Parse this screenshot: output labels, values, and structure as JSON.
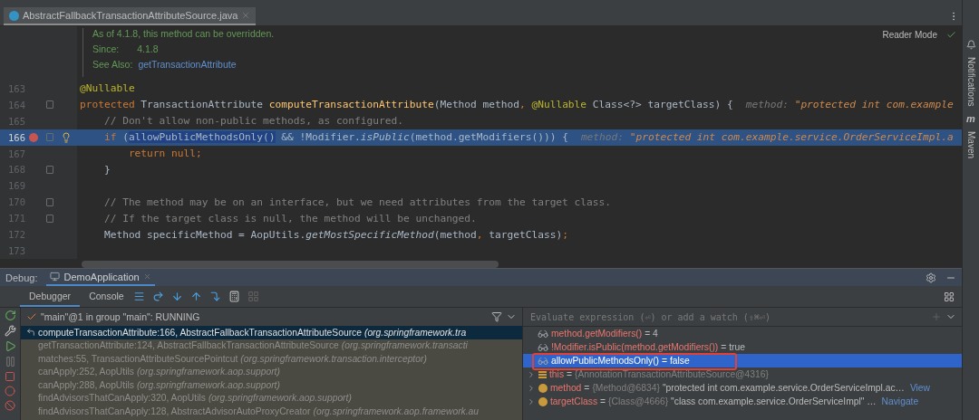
{
  "editor_tab": {
    "label": "AbstractFallbackTransactionAttributeSource.java",
    "selected": true
  },
  "reader_mode": "Reader Mode",
  "doc": {
    "note": "As of 4.1.8, this method can be overridden.",
    "since_label": "Since:",
    "since_value": "4.1.8",
    "see_label": "See Also:",
    "see_link": "getTransactionAttribute"
  },
  "code_lines": [
    {
      "number": "163",
      "current": false,
      "breakpoint": false,
      "fold": false,
      "tokens": [
        {
          "t": "@Nullable",
          "kind": "annotation"
        }
      ]
    },
    {
      "number": "164",
      "current": false,
      "breakpoint": false,
      "fold": true,
      "tokens": [
        {
          "t": "protected",
          "kind": "keyword"
        },
        {
          "t": " TransactionAttribute ",
          "kind": "plain"
        },
        {
          "t": "computeTransactionAttribute",
          "kind": "declaration"
        },
        {
          "t": "(Method method",
          "kind": "plain"
        },
        {
          "t": ", ",
          "kind": "keyword"
        },
        {
          "t": "@Nullable",
          "kind": "annotation"
        },
        {
          "t": " Class<?> targetClass) {",
          "kind": "plain"
        }
      ],
      "hint_key": "method:",
      "hint_value": "\"protected int com.example"
    },
    {
      "number": "165",
      "current": false,
      "breakpoint": false,
      "fold": false,
      "tokens": [
        {
          "t": "    // Don't allow non-public methods, as configured.",
          "kind": "comment"
        }
      ]
    },
    {
      "number": "166",
      "current": true,
      "breakpoint": true,
      "fold": true,
      "tokens": [
        {
          "t": "    if",
          "kind": "keyword"
        },
        {
          "t": " (",
          "kind": "plain"
        },
        {
          "t": "allowPublicMethodsOnly()",
          "kind": "selection"
        },
        {
          "t": " && !Modifier.",
          "kind": "plain"
        },
        {
          "t": "isPublic",
          "kind": "static"
        },
        {
          "t": "(method.getModifiers())) {",
          "kind": "plain"
        }
      ],
      "hint_key": "method:",
      "hint_value": "\"protected int com.example.service.OrderServiceImpl.a"
    },
    {
      "number": "167",
      "current": false,
      "breakpoint": false,
      "fold": false,
      "tokens": [
        {
          "t": "        return null;",
          "kind": "keyword"
        }
      ]
    },
    {
      "number": "168",
      "current": false,
      "breakpoint": false,
      "fold": true,
      "tokens": [
        {
          "t": "    }",
          "kind": "plain"
        }
      ]
    },
    {
      "number": "169",
      "current": false,
      "breakpoint": false,
      "fold": false
    },
    {
      "number": "170",
      "current": false,
      "breakpoint": false,
      "fold": true,
      "tokens": [
        {
          "t": "    // The method may be on an interface, but we need attributes from the target class.",
          "kind": "comment"
        }
      ]
    },
    {
      "number": "171",
      "current": false,
      "breakpoint": false,
      "fold": true,
      "tokens": [
        {
          "t": "    // If the target class is null, the method will be unchanged.",
          "kind": "comment"
        }
      ]
    },
    {
      "number": "172",
      "current": false,
      "breakpoint": false,
      "fold": false,
      "tokens": [
        {
          "t": "    Method specificMethod = AopUtils.",
          "kind": "plain"
        },
        {
          "t": "getMostSpecificMethod",
          "kind": "static"
        },
        {
          "t": "(method",
          "kind": "plain"
        },
        {
          "t": ", ",
          "kind": "keyword"
        },
        {
          "t": "targetClass)",
          "kind": "plain"
        },
        {
          "t": ";",
          "kind": "keyword"
        }
      ]
    },
    {
      "number": "173",
      "current": false,
      "breakpoint": false,
      "fold": false
    }
  ],
  "side_tools": [
    "Notifications",
    "Maven"
  ],
  "maven_glyph": "m",
  "debug": {
    "title": "Debug:",
    "session": "DemoApplication",
    "tabs": [
      {
        "label": "Debugger",
        "selected": true
      },
      {
        "label": "Console",
        "selected": false
      }
    ],
    "thread": "\"main\"@1 in group \"main\": RUNNING",
    "frames": [
      {
        "method": "computeTransactionAttribute:166, AbstractFallbackTransactionAttributeSource",
        "package": "(org.springframework.tra",
        "selected": true
      },
      {
        "method": "getTransactionAttribute:124, AbstractFallbackTransactionAttributeSource",
        "package": "(org.springframework.transacti",
        "selected": false
      },
      {
        "method": "matches:55, TransactionAttributeSourcePointcut",
        "package": "(org.springframework.transaction.interceptor)",
        "selected": false
      },
      {
        "method": "canApply:252, AopUtils",
        "package": "(org.springframework.aop.support)",
        "selected": false
      },
      {
        "method": "canApply:288, AopUtils",
        "package": "(org.springframework.aop.support)",
        "selected": false
      },
      {
        "method": "findAdvisorsThatCanApply:320, AopUtils",
        "package": "(org.springframework.aop.support)",
        "selected": false
      },
      {
        "method": "findAdvisorsThatCanApply:128, AbstractAdvisorAutoProxyCreator",
        "package": "(org.springframework.aop.framework.au",
        "selected": false
      }
    ],
    "evaluate_placeholder": "Evaluate expression (⏎) or add a watch (⇧⌘⏎)",
    "variables": [
      {
        "kind": "watch",
        "name": "method.getModifiers()",
        "value": " = 4",
        "selected": false,
        "annotated": false
      },
      {
        "kind": "watch",
        "name": "!Modifier.isPublic(method.getModifiers())",
        "value": " = true",
        "selected": false,
        "annotated": false
      },
      {
        "kind": "watch",
        "name": "allowPublicMethodsOnly()",
        "value": " = false",
        "selected": true,
        "annotated": true
      },
      {
        "kind": "field",
        "name": "this",
        "value": " = ",
        "ref": "{AnnotationTransactionAttributeSource@4316}",
        "selected": false,
        "annotated": false
      },
      {
        "kind": "param",
        "name": "method",
        "value": " = ",
        "ref": "{Method@6834}",
        "text": " \"protected int com.example.service.OrderServiceImpl.ac…",
        "link": "View",
        "selected": false,
        "annotated": false
      },
      {
        "kind": "param",
        "name": "targetClass",
        "value": " = ",
        "ref": "{Class@4666}",
        "text": " \"class com.example.service.OrderServiceImpl\" …",
        "link": "Navigate",
        "selected": false,
        "annotated": false
      }
    ]
  }
}
